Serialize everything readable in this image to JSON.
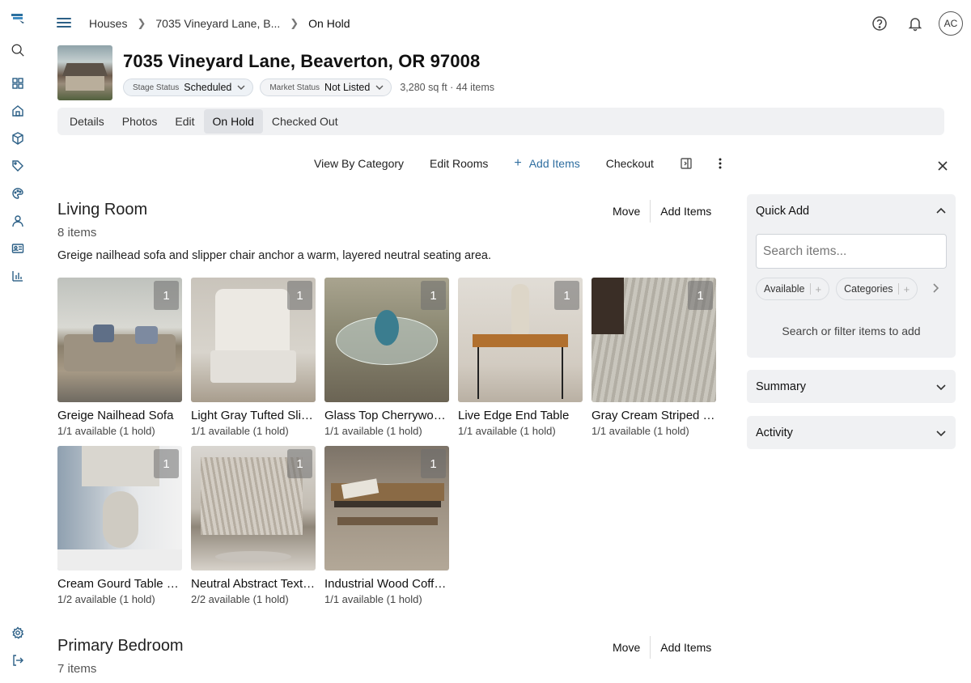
{
  "breadcrumb": [
    "Houses",
    "7035 Vineyard Lane, B...",
    "On Hold"
  ],
  "user": {
    "initials": "AC"
  },
  "property": {
    "title": "7035 Vineyard Lane, Beaverton, OR 97008",
    "stage_status_label": "Stage Status",
    "stage_status_value": "Scheduled",
    "market_status_label": "Market Status",
    "market_status_value": "Not Listed",
    "meta": "3,280 sq ft · 44 items"
  },
  "tabs": [
    {
      "label": "Details"
    },
    {
      "label": "Photos"
    },
    {
      "label": "Edit"
    },
    {
      "label": "On Hold",
      "active": true
    },
    {
      "label": "Checked Out"
    }
  ],
  "toolbar": {
    "view_by_category": "View By Category",
    "edit_rooms": "Edit Rooms",
    "add_items": "Add Items",
    "checkout": "Checkout"
  },
  "sections": [
    {
      "title": "Living Room",
      "count": "8 items",
      "description": "Greige nailhead sofa and slipper chair anchor a warm, layered neutral seating area.",
      "move_label": "Move",
      "add_items_label": "Add Items",
      "items": [
        {
          "name": "Greige Nailhead Sofa",
          "availability": "1/1 available (1 hold)",
          "qty": "1"
        },
        {
          "name": "Light Gray Tufted Slipper Chair",
          "availability": "1/1 available (1 hold)",
          "qty": "1"
        },
        {
          "name": "Glass Top Cherrywood Table",
          "availability": "1/1 available (1 hold)",
          "qty": "1"
        },
        {
          "name": "Live Edge End Table",
          "availability": "1/1 available (1 hold)",
          "qty": "1"
        },
        {
          "name": "Gray Cream Striped Rug",
          "availability": "1/1 available (1 hold)",
          "qty": "1"
        },
        {
          "name": "Cream Gourd Table Lamp",
          "availability": "1/2 available (1 hold)",
          "qty": "1"
        },
        {
          "name": "Neutral Abstract Textured Art",
          "availability": "2/2 available (1 hold)",
          "qty": "1"
        },
        {
          "name": "Industrial Wood Coffee Table",
          "availability": "1/1 available (1 hold)",
          "qty": "1"
        }
      ]
    },
    {
      "title": "Primary Bedroom",
      "count": "7 items",
      "move_label": "Move",
      "add_items_label": "Add Items"
    }
  ],
  "quick_add": {
    "title": "Quick Add",
    "search_placeholder": "Search items...",
    "chips": [
      "Available",
      "Categories"
    ],
    "hint": "Search or filter items to add"
  },
  "summary": {
    "title": "Summary"
  },
  "activity": {
    "title": "Activity"
  },
  "colors": {
    "accent": "#2f6ea0",
    "panel_bg": "#f0f1f3",
    "tabs_bg": "#f0f1f3"
  }
}
